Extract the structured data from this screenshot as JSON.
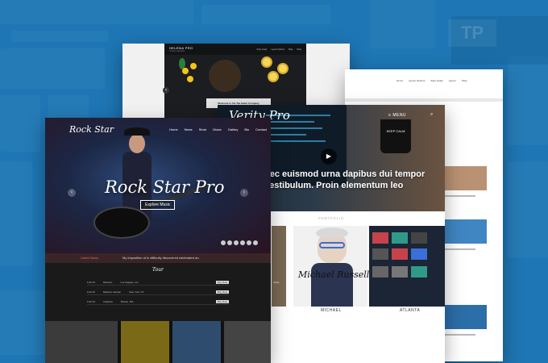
{
  "helena": {
    "brand": "HELENA PRO",
    "subtitle": "Healthy Appetites",
    "nav": [
      "Style Guide",
      "Layout Options",
      "Blog",
      "Shop"
    ],
    "caption": "Welcome to the Tea Salon Company"
  },
  "right_card": {
    "nav": [
      "Home",
      "Layout Options",
      "Style Guide",
      "Layout",
      "Shop"
    ]
  },
  "verity": {
    "title": "Verity Pro",
    "menu_label": "MENU",
    "mug_text": "KEEP CALM",
    "headline_line1": "nec euismod urna dapibus dui tempor",
    "headline_line2": "vestibulum. Proin elementum leo",
    "portfolio_label": "PORTFOLIO",
    "signature": "Michael Russell",
    "caption1": "MICHAEL",
    "caption2": "ATLANTA",
    "tile_text": "Verity"
  },
  "rock": {
    "brand": "Rock Star",
    "nav": [
      "Home",
      "News",
      "Store",
      "Music",
      "Gallery",
      "Bio",
      "Contact"
    ],
    "title": "Rock Star Pro",
    "button": "Explore Music",
    "strip_label": "Latest News",
    "strip_text": "My imposition of in difficulty discovered celebrated an.",
    "tour_title": "Tour",
    "tour_rows": [
      {
        "date": "6.20.15",
        "venue": "Mansion",
        "city": "Los Angeles, CA"
      },
      {
        "date": "6.20.15",
        "venue": "Madison Garden",
        "city": "New York, NY"
      },
      {
        "date": "6.20.15",
        "venue": "Captains",
        "city": "Boston, MA"
      }
    ],
    "buy_label": "Buy Now"
  },
  "icons": {
    "prev": "prev-arrow-icon",
    "next": "next-arrow-icon",
    "play": "play-icon",
    "search": "search-icon",
    "menu": "menu-icon"
  },
  "colors": {
    "background": "#1f77b3",
    "rock_accent": "#d76a5a"
  }
}
